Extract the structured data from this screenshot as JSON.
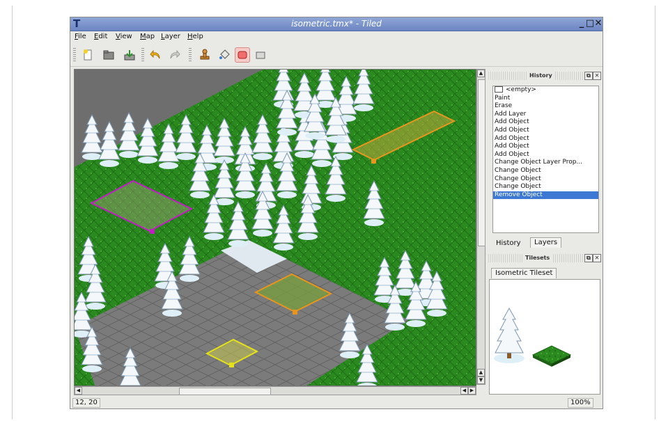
{
  "window": {
    "title": "isometric.tmx* - Tiled",
    "app_icon": "T",
    "minimize_label": "_",
    "maximize_label": "□",
    "close_label": "✕"
  },
  "menu": [
    {
      "accel": "F",
      "rest": "ile"
    },
    {
      "accel": "E",
      "rest": "dit"
    },
    {
      "accel": "V",
      "rest": "iew"
    },
    {
      "accel": "M",
      "rest": "ap"
    },
    {
      "accel": "L",
      "rest": "ayer"
    },
    {
      "accel": "H",
      "rest": "elp"
    }
  ],
  "toolbar": {
    "icons": [
      "new-file-icon",
      "open-folder-icon",
      "save-icon",
      "undo-icon",
      "redo-icon",
      "stamp-brush-icon",
      "bucket-fill-icon",
      "eraser-icon",
      "select-icon"
    ],
    "active_tool": "eraser-icon"
  },
  "history": {
    "title": "History",
    "items": [
      "<empty>",
      "Paint",
      "Erase",
      "Add Layer",
      "Add Object",
      "Add Object",
      "Add Object",
      "Add Object",
      "Add Object",
      "Change Object Layer Prop...",
      "Change Object",
      "Change Object",
      "Change Object",
      "Remove Object"
    ],
    "selected_index": 13
  },
  "tabs": {
    "history": "History",
    "layers": "Layers"
  },
  "tilesets": {
    "title": "Tilesets",
    "tab": "Isometric Tileset"
  },
  "status": {
    "coords": "12, 20",
    "zoom": "100%"
  },
  "colors": {
    "grass": "#2e8b22",
    "road": "#7a7a7a",
    "object_orange": "#e8951e",
    "object_magenta": "#c21cc4",
    "object_yellow": "#e6e21a",
    "selection": "#3d79d4"
  }
}
